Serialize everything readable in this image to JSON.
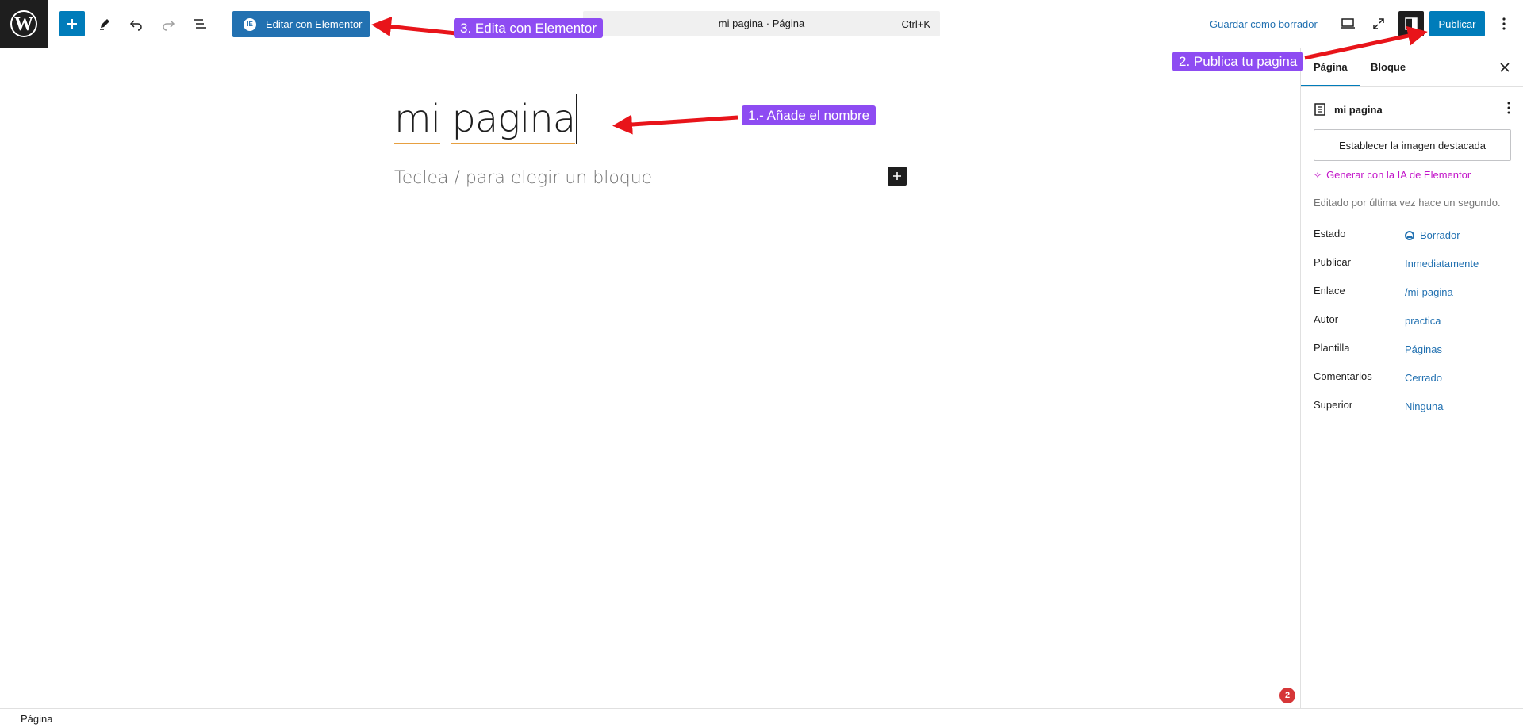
{
  "toolbar": {
    "elementor_label": "Editar con Elementor",
    "elementor_badge": "IE",
    "command_title": "mi pagina · Página",
    "command_shortcut": "Ctrl+K",
    "save_draft": "Guardar como borrador",
    "publish": "Publicar"
  },
  "editor": {
    "title_word1": "mi",
    "title_word2": "pagina",
    "placeholder": "Teclea / para elegir un bloque"
  },
  "sidebar": {
    "tab_page": "Página",
    "tab_block": "Bloque",
    "doc_name": "mi pagina",
    "featured_image": "Establecer la imagen destacada",
    "ai_link": "Generar con la IA de Elementor",
    "last_edited": "Editado por última vez hace un segundo.",
    "meta": [
      {
        "key": "Estado",
        "value": "Borrador"
      },
      {
        "key": "Publicar",
        "value": "Inmediatamente"
      },
      {
        "key": "Enlace",
        "value": "/mi-pagina"
      },
      {
        "key": "Autor",
        "value": "practica"
      },
      {
        "key": "Plantilla",
        "value": "Páginas"
      },
      {
        "key": "Comentarios",
        "value": "Cerrado"
      },
      {
        "key": "Superior",
        "value": "Ninguna"
      }
    ]
  },
  "footer": {
    "breadcrumb": "Página",
    "notification_count": "2"
  },
  "annotations": {
    "step1": "1.- Añade el nombre",
    "step2": "2. Publica tu pagina",
    "step3": "3. Edita con Elementor"
  },
  "colors": {
    "accent": "#007cba",
    "annotation": "#8e4cf2",
    "arrow": "#e8141a"
  }
}
